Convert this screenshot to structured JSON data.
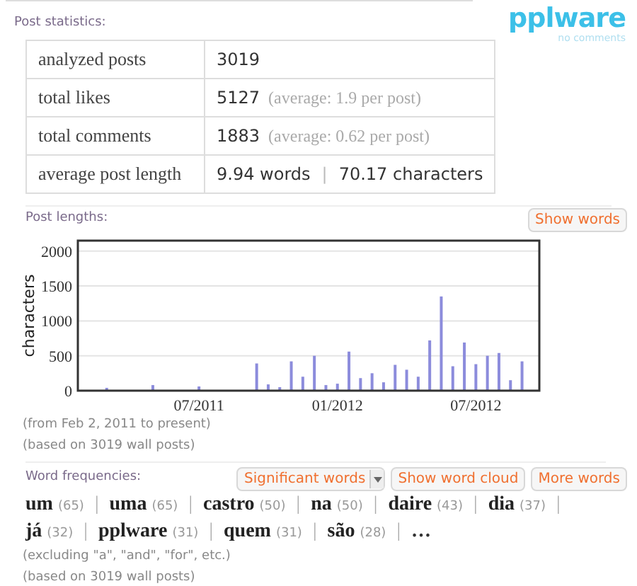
{
  "logo": {
    "name": "pplware",
    "tagline": "no comments"
  },
  "post_statistics": {
    "title": "Post statistics:",
    "rows": [
      {
        "label": "analyzed posts",
        "value": "3019"
      },
      {
        "label": "total likes",
        "value": "5127",
        "note": "(average: 1.9 per post)"
      },
      {
        "label": "total comments",
        "value": "1883",
        "note": "(average: 0.62 per post)"
      },
      {
        "label": "average post length",
        "value": "9.94 words",
        "separator": "|",
        "value_2": "70.17 characters"
      }
    ]
  },
  "post_lengths": {
    "title": "Post lengths:",
    "button": "Show words",
    "chart_data": {
      "type": "bar",
      "grid": true,
      "ylabel": "characters",
      "ylim": [
        0,
        2150
      ],
      "yticks": [
        0,
        500,
        1000,
        1500,
        2000
      ],
      "categories": [
        null,
        null,
        null,
        null,
        null,
        null,
        null,
        null,
        null,
        null,
        "07/2011",
        null,
        null,
        null,
        null,
        null,
        null,
        null,
        null,
        null,
        null,
        null,
        "01/2012",
        null,
        null,
        null,
        null,
        null,
        null,
        null,
        null,
        null,
        null,
        null,
        "07/2012",
        null,
        null,
        null,
        null,
        null
      ],
      "series": [
        {
          "color": "#8c8cdc",
          "values": [
            null,
            null,
            40,
            null,
            null,
            null,
            80,
            null,
            null,
            null,
            60,
            null,
            null,
            null,
            null,
            390,
            90,
            50,
            420,
            200,
            500,
            80,
            100,
            560,
            180,
            250,
            120,
            370,
            300,
            200,
            720,
            1350,
            350,
            690,
            380,
            500,
            540,
            150,
            420,
            null
          ]
        }
      ]
    },
    "notes": [
      "(from Feb 2, 2011 to present)",
      "(based on 3019 wall posts)"
    ]
  },
  "word_frequencies": {
    "title": "Word frequencies:",
    "dropdown": "Significant words",
    "buttons": [
      "Show word cloud",
      "More words"
    ],
    "words": [
      {
        "word": "um",
        "count": "(65)"
      },
      {
        "word": "uma",
        "count": "(65)"
      },
      {
        "word": "castro",
        "count": "(50)"
      },
      {
        "word": "na",
        "count": "(50)"
      },
      {
        "word": "daire",
        "count": "(43)"
      },
      {
        "word": "dia",
        "count": "(37)"
      },
      {
        "word": "já",
        "count": "(32)"
      },
      {
        "word": "pplware",
        "count": "(31)"
      },
      {
        "word": "quem",
        "count": "(31)"
      },
      {
        "word": "são",
        "count": "(28)"
      }
    ],
    "separator": "|",
    "more": "…",
    "notes": [
      "(excluding \"a\", \"and\", \"for\", etc.)",
      "(based on 3019 wall posts)"
    ]
  }
}
